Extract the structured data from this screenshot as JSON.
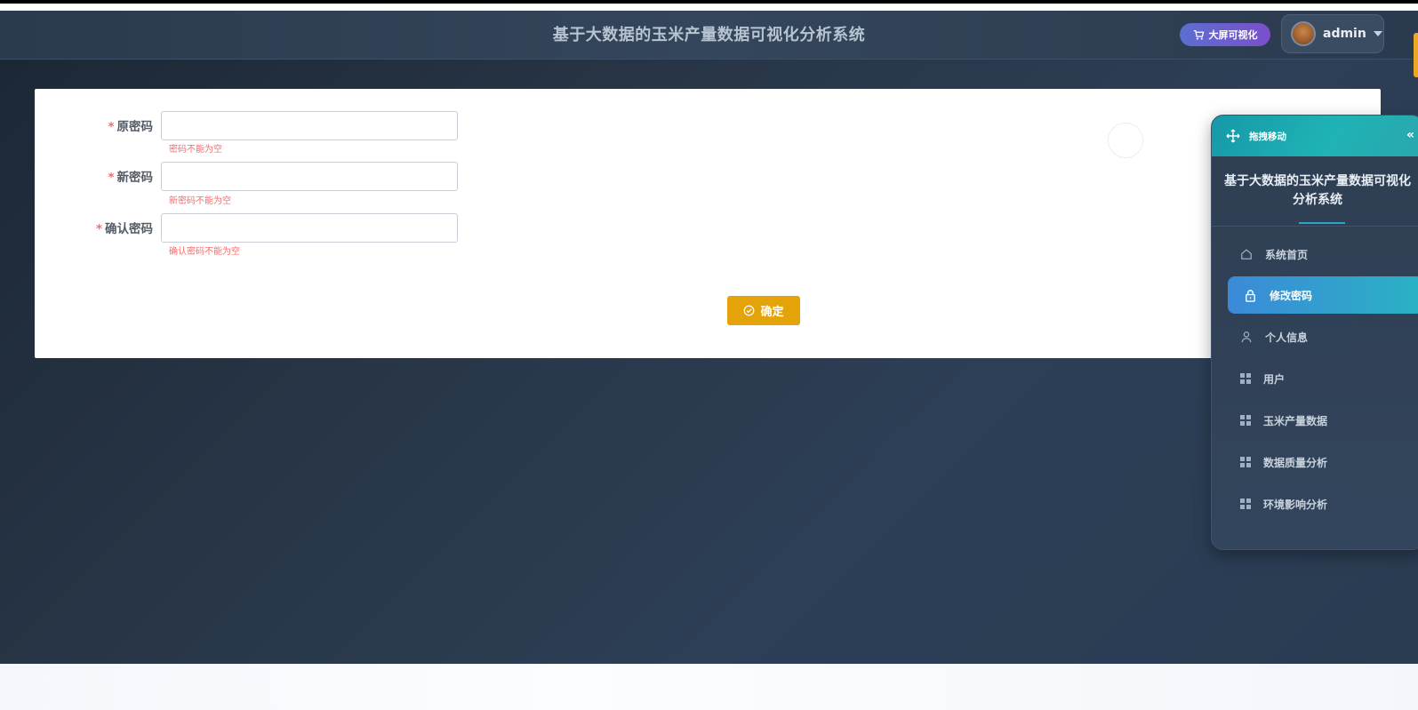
{
  "header": {
    "title": "基于大数据的玉米产量数据可视化分析系统",
    "bigscreen_label": "大屏可视化",
    "username": "admin"
  },
  "form": {
    "fields": [
      {
        "label": "原密码",
        "value": "",
        "error": "密码不能为空"
      },
      {
        "label": "新密码",
        "value": "",
        "error": "新密码不能为空"
      },
      {
        "label": "确认密码",
        "value": "",
        "error": "确认密码不能为空"
      }
    ],
    "required_mark": "*",
    "submit_label": "确定"
  },
  "menu": {
    "drag_label": "拖拽移动",
    "collapse_glyph": "«",
    "title": "基于大数据的玉米产量数据可视化分析系统",
    "items": [
      {
        "label": "系统首页",
        "icon": "home-icon"
      },
      {
        "label": "修改密码",
        "icon": "lock-icon",
        "active": true
      },
      {
        "label": "个人信息",
        "icon": "user-icon"
      },
      {
        "label": "用户",
        "icon": "grid-icon"
      },
      {
        "label": "玉米产量数据",
        "icon": "grid-icon"
      },
      {
        "label": "数据质量分析",
        "icon": "grid-icon"
      },
      {
        "label": "环境影响分析",
        "icon": "grid-icon"
      }
    ]
  },
  "colors": {
    "accent": "#e5a30a",
    "active_menu": "#3b8ad8",
    "error": "#f56c6c",
    "teal": "#1fb3b5"
  }
}
